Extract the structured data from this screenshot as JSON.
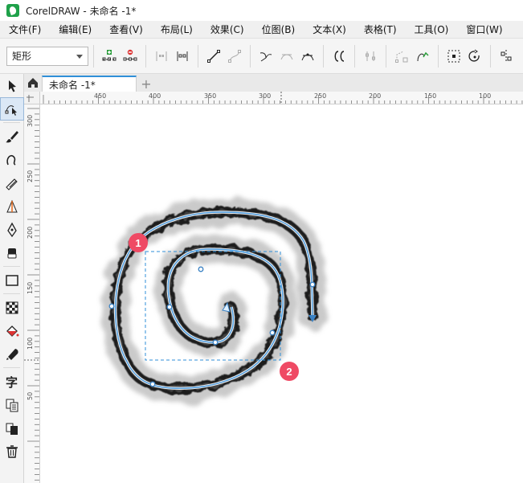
{
  "app": {
    "title": "CorelDRAW - 未命名 -1*"
  },
  "menu": [
    "文件(F)",
    "编辑(E)",
    "查看(V)",
    "布局(L)",
    "效果(C)",
    "位图(B)",
    "文本(X)",
    "表格(T)",
    "工具(O)",
    "窗口(W)"
  ],
  "toolbar": {
    "shape_select_value": "矩形"
  },
  "tabs": {
    "document_name": "未命名 -1*"
  },
  "ruler": {
    "horizontal_labels": [
      "450",
      "400",
      "350",
      "300",
      "250",
      "200",
      "150",
      "100"
    ],
    "vertical_labels": [
      "300",
      "250",
      "200",
      "150",
      "100",
      "50"
    ]
  },
  "annotations": {
    "badge1": "1",
    "badge2": "2"
  },
  "colors": {
    "selection_blue": "#2f8fd8",
    "badge_red": "#ef4a64",
    "brush_dark": "#222222"
  }
}
